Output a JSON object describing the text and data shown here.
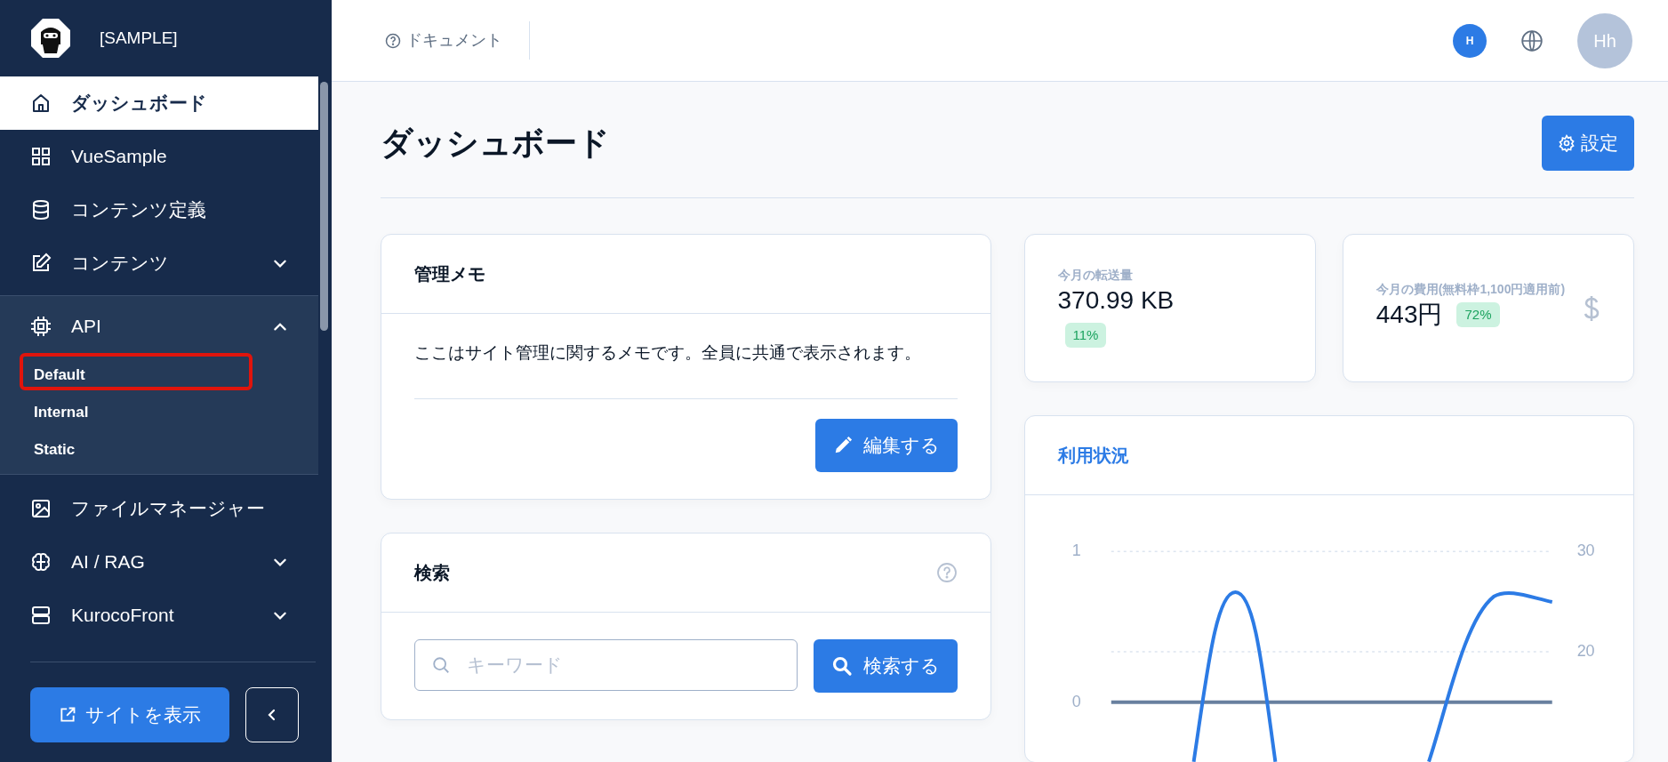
{
  "sidebar": {
    "brand": "[SAMPLE]",
    "items": [
      {
        "kind": "link",
        "label": "ダッシュボード",
        "selected": true
      },
      {
        "kind": "link",
        "label": "VueSample",
        "selected": false
      },
      {
        "kind": "link",
        "label": "コンテンツ定義",
        "selected": false
      },
      {
        "kind": "group",
        "label": "コンテンツ",
        "selected": false,
        "expanded": false
      },
      {
        "kind": "group",
        "label": "API",
        "selected": false,
        "expanded": true,
        "children": [
          {
            "label": "Default",
            "highlighted": true
          },
          {
            "label": "Internal",
            "highlighted": false
          },
          {
            "label": "Static",
            "highlighted": false
          }
        ]
      },
      {
        "kind": "link",
        "label": "ファイルマネージャー",
        "selected": false
      },
      {
        "kind": "group",
        "label": "AI / RAG",
        "selected": false,
        "expanded": false
      },
      {
        "kind": "group",
        "label": "KurocoFront",
        "selected": false,
        "expanded": false
      }
    ],
    "view_site_button": "サイトを表示"
  },
  "header": {
    "docs_link": "ドキュメント",
    "user_badge": "H",
    "avatar": "Hh"
  },
  "page": {
    "title": "ダッシュボード",
    "settings_button": "設定"
  },
  "memo_card": {
    "title": "管理メモ",
    "text": "ここはサイト管理に関するメモです。全員に共通で表示されます。",
    "edit_button": "編集する"
  },
  "search_card": {
    "title": "検索",
    "placeholder": "キーワード",
    "search_button": "検索する"
  },
  "stats": [
    {
      "label": "今月の転送量",
      "value": "370.99 KB",
      "change": "11%"
    },
    {
      "label": "今月の費用(無料枠1,100円適用前)",
      "value": "443円",
      "change": "72%"
    }
  ],
  "usage_card": {
    "title": "利用状況",
    "left_ticks": [
      "1",
      "0"
    ],
    "right_ticks": [
      "30",
      "20"
    ]
  }
}
